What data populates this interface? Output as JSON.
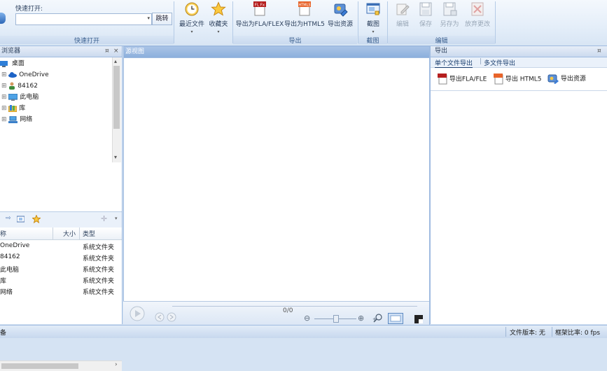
{
  "ribbon": {
    "quick_open": {
      "label": "快速打开:",
      "input_value": "",
      "jump_label": "跳转",
      "group_caption": "快速打开"
    },
    "recent_label": "最近文件",
    "favorites_label": "收藏夹",
    "export_fla_label": "导出为FLA/FLEX",
    "export_html5_label": "导出为HTML5",
    "export_resources_label": "导出资源",
    "export_group_caption": "导出",
    "screenshot_label": "截图",
    "screenshot_group_caption": "截图",
    "edit_label": "编辑",
    "save_label": "保存",
    "saveas_label": "另存为",
    "discard_label": "放弃更改",
    "edit_group_caption": "编辑",
    "icon_text": {
      "fla": "FL Fx",
      "html5": "HTML5"
    }
  },
  "left_panel": {
    "title": "浏览器",
    "pin_glyph": "¤",
    "close_glyph": "×",
    "tree": [
      {
        "label": "桌面",
        "icon": "desktop-icon"
      },
      {
        "label": "OneDrive",
        "icon": "cloud-icon"
      },
      {
        "label": "84162",
        "icon": "user-icon"
      },
      {
        "label": "此电脑",
        "icon": "computer-icon"
      },
      {
        "label": "库",
        "icon": "library-icon"
      },
      {
        "label": "网络",
        "icon": "network-icon"
      }
    ],
    "columns": {
      "name": "称",
      "size": "大小",
      "type": "类型"
    },
    "rows": [
      {
        "name": "OneDrive",
        "type": "系统文件夹"
      },
      {
        "name": "84162",
        "type": "系统文件夹"
      },
      {
        "name": "此电脑",
        "type": "系统文件夹"
      },
      {
        "name": "库",
        "type": "系统文件夹"
      },
      {
        "name": "网络",
        "type": "系统文件夹"
      }
    ]
  },
  "center": {
    "title": "源视图",
    "player": {
      "counter": "0/0"
    }
  },
  "right_panel": {
    "title": "导出",
    "pin_glyph": "¤",
    "tabs": [
      "单个文件导出",
      "多文件导出"
    ],
    "buttons": {
      "fla": "导出FLA/FLE",
      "html5": "导出 HTML5",
      "resources": "导出资源"
    }
  },
  "status": {
    "left": "备",
    "file_version": "文件版本: 无",
    "frame_rate": "框架比率: 0 fps"
  },
  "colors": {
    "accent": "#1d63c6",
    "panel_border": "#9fbbe0"
  }
}
